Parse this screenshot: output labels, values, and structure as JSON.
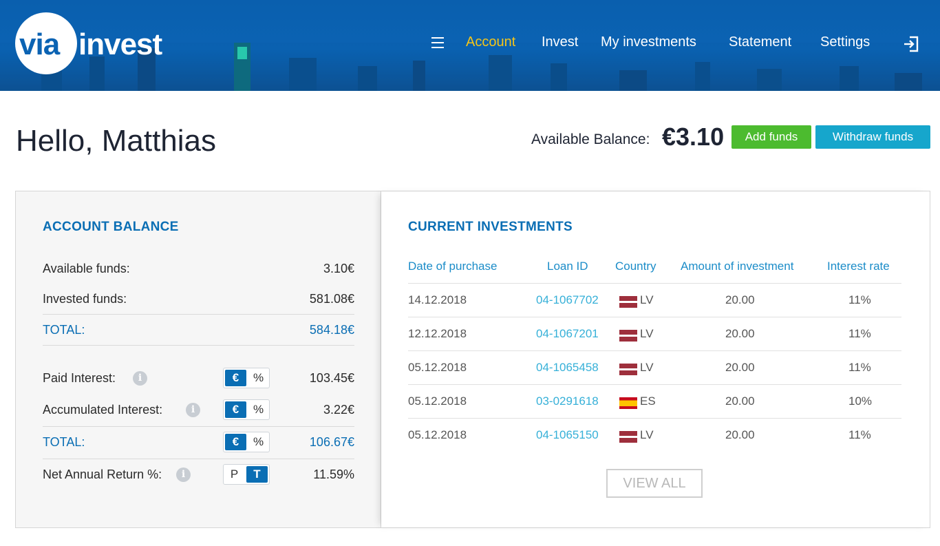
{
  "header": {
    "logo_part1": "via",
    "logo_part2": "invest",
    "nav": [
      "Account",
      "Invest",
      "My investments",
      "Statement",
      "Settings"
    ],
    "active_nav": "Account",
    "menu_icon": "hamburger-icon",
    "logout_icon": "logout-icon"
  },
  "greeting": "Hello, Matthias",
  "balance": {
    "label": "Available Balance:",
    "value": "€3.10",
    "add_label": "Add funds",
    "withdraw_label": "Withdraw funds"
  },
  "account_balance": {
    "title": "ACCOUNT BALANCE",
    "available_label": "Available funds:",
    "available_value": "3.10€",
    "invested_label": "Invested funds:",
    "invested_value": "581.08€",
    "total_label": "TOTAL:",
    "total_value": "584.18€",
    "paid_label": "Paid Interest:",
    "paid_value": "103.45€",
    "accum_label": "Accumulated Interest:",
    "accum_value": "3.22€",
    "total2_label": "TOTAL:",
    "total2_value": "106.67€",
    "nar_label": "Net Annual Return %:",
    "nar_value": "11.59%",
    "toggle_euro": "€",
    "toggle_pct": "%",
    "toggle_p": "P",
    "toggle_t": "T",
    "info_glyph": "i"
  },
  "investments": {
    "title": "CURRENT INVESTMENTS",
    "headers": [
      "Date of purchase",
      "Loan ID",
      "Country",
      "Amount of investment",
      "Interest rate"
    ],
    "rows": [
      {
        "date": "14.12.2018",
        "loan": "04-1067702",
        "country": "LV",
        "amount": "20.00",
        "rate": "11%"
      },
      {
        "date": "12.12.2018",
        "loan": "04-1067201",
        "country": "LV",
        "amount": "20.00",
        "rate": "11%"
      },
      {
        "date": "05.12.2018",
        "loan": "04-1065458",
        "country": "LV",
        "amount": "20.00",
        "rate": "11%"
      },
      {
        "date": "05.12.2018",
        "loan": "03-0291618",
        "country": "ES",
        "amount": "20.00",
        "rate": "10%"
      },
      {
        "date": "05.12.2018",
        "loan": "04-1065150",
        "country": "LV",
        "amount": "20.00",
        "rate": "11%"
      }
    ],
    "view_all": "VIEW ALL"
  },
  "colors": {
    "brand_blue": "#0b63b3",
    "accent_yellow": "#f5c518",
    "add_green": "#4cbb2f",
    "withdraw_cyan": "#16a6cc",
    "link_blue": "#36b0d8"
  }
}
